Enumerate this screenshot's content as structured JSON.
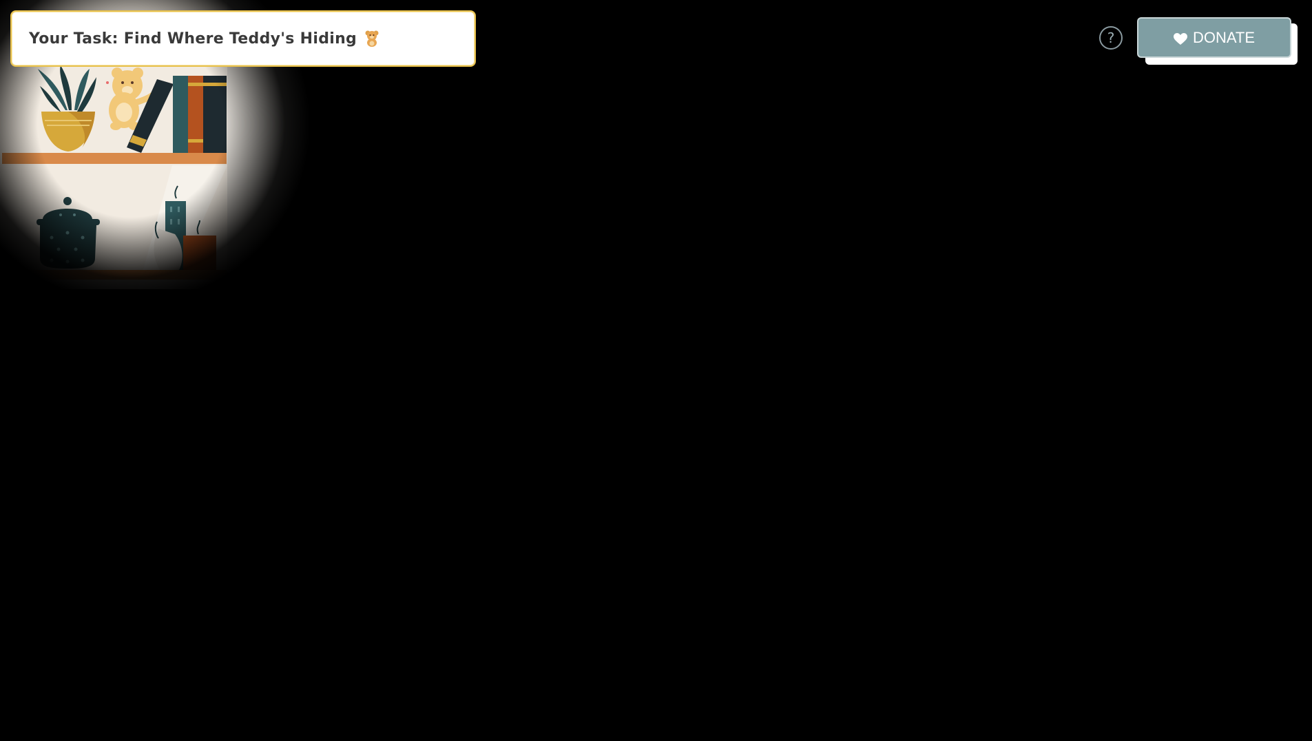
{
  "task": {
    "label": "Your Task: Find Where Teddy's Hiding",
    "emoji_icon": "teddy-bear-icon"
  },
  "help": {
    "label": "?"
  },
  "donate": {
    "label": "DONATE",
    "icon": "heart-icon"
  },
  "colors": {
    "background": "#000000",
    "banner_border": "#e8c14d",
    "donate_bg": "#7f9ea3",
    "shelf": "#d98a4a",
    "wall": "#f3ede4",
    "dark_teal": "#1f3a3d",
    "teal": "#2f5a5e",
    "rust": "#b4521f",
    "mustard": "#d6a83a"
  }
}
